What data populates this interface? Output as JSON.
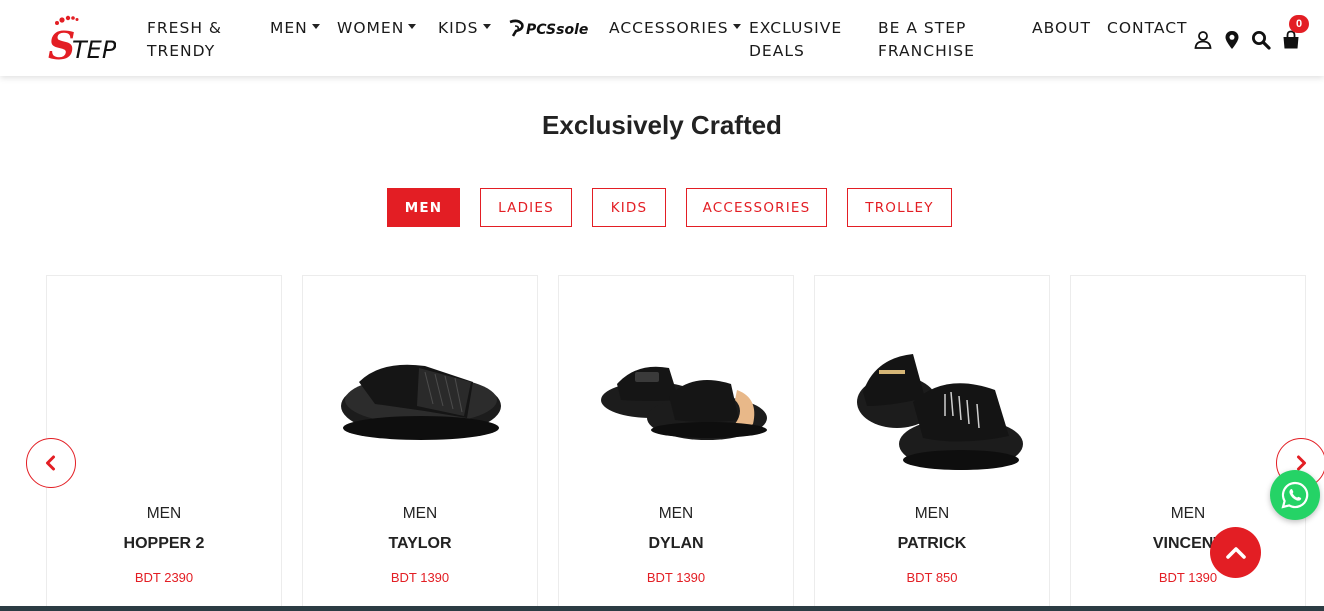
{
  "brand": {
    "logo_text": "STEP",
    "accent_color": "#e31e24"
  },
  "nav": {
    "fresh_line1": "FRESH &",
    "fresh_line2": "TRENDY",
    "men": "MEN",
    "women": "WOMEN",
    "kids": "KIDS",
    "pcs_logo": "PCSsole",
    "accessories": "ACCESSORIES",
    "exclusive_line1": "EXCLUSIVE",
    "exclusive_line2": "DEALS",
    "franchise_line1": "BE A STEP",
    "franchise_line2": "FRANCHISE",
    "about": "ABOUT",
    "contact": "CONTACT",
    "cart_count": "0",
    "icons": [
      "user-icon",
      "location-pin-icon",
      "search-icon",
      "shopping-bag-icon"
    ]
  },
  "section": {
    "title": "Exclusively Crafted"
  },
  "tabs": [
    {
      "label": "MEN",
      "active": true
    },
    {
      "label": "LADIES",
      "active": false
    },
    {
      "label": "KIDS",
      "active": false
    },
    {
      "label": "ACCESSORIES",
      "active": false
    },
    {
      "label": "TROLLEY",
      "active": false
    }
  ],
  "products": [
    {
      "category": "MEN",
      "name": "HOPPER 2",
      "price": "BDT 2390"
    },
    {
      "category": "MEN",
      "name": "TAYLOR",
      "price": "BDT 1390"
    },
    {
      "category": "MEN",
      "name": "DYLAN",
      "price": "BDT 1390"
    },
    {
      "category": "MEN",
      "name": "PATRICK",
      "price": "BDT 850"
    },
    {
      "category": "MEN",
      "name": "VINCENT",
      "price": "BDT 1390"
    }
  ]
}
